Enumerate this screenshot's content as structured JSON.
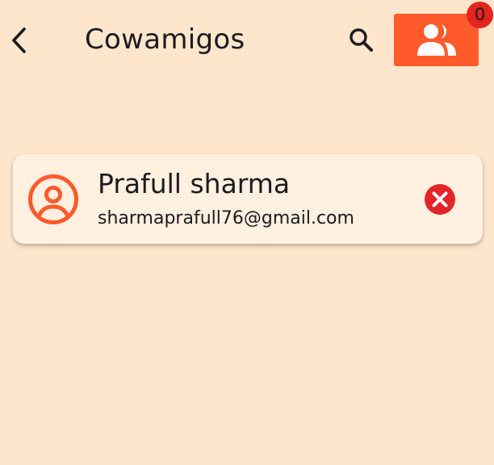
{
  "app_bar": {
    "title": "Cowamigos",
    "back_icon": "chevron-left-icon",
    "search_icon": "search-icon",
    "friends_icon": "group-icon",
    "friend_requests_count": "0"
  },
  "user_list": [
    {
      "name": "Prafull sharma",
      "email": "sharmaprafull76@gmail.com",
      "avatar_icon": "account-circle-icon",
      "action_icon": "remove-circle-icon"
    }
  ],
  "colors": {
    "background": "#fde6cc",
    "card": "#fff0e0",
    "accent": "#ff5a2b",
    "badge": "#e3241f",
    "remove": "#e3242b",
    "text": "#1c1b1f"
  }
}
